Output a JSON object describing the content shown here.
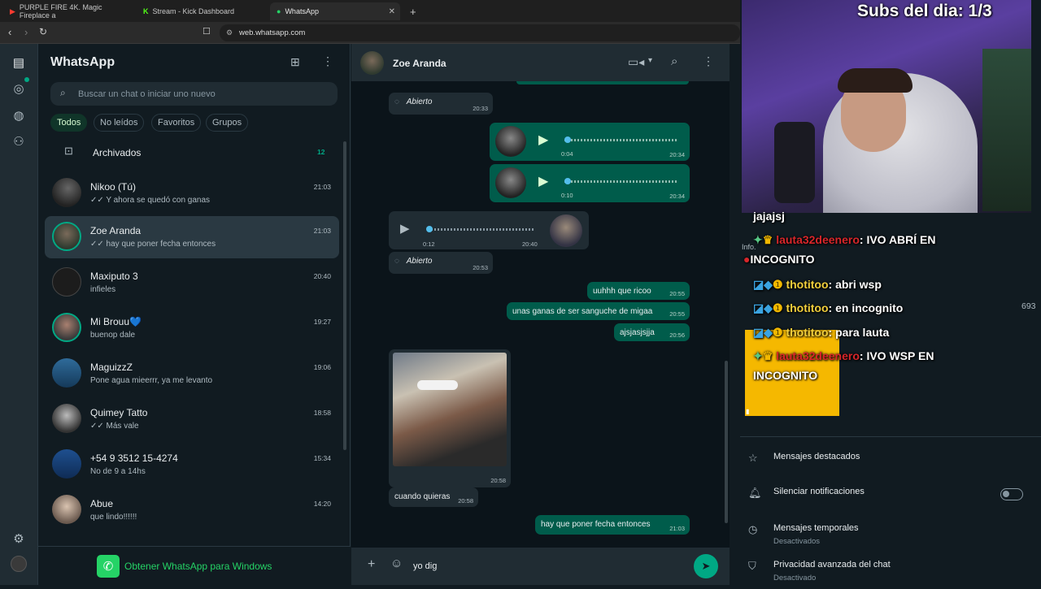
{
  "browser": {
    "tabs": [
      {
        "label": "PURPLE FIRE 4K. Magic Fireplace a"
      },
      {
        "label": "Stream - Kick Dashboard"
      },
      {
        "label": "WhatsApp"
      }
    ],
    "url": "web.whatsapp.com"
  },
  "sidebar": {
    "title": "WhatsApp",
    "search_placeholder": "Buscar un chat o iniciar uno nuevo",
    "filters": [
      "Todos",
      "No leídos",
      "Favoritos",
      "Grupos"
    ],
    "archived_label": "Archivados",
    "archived_count": "12",
    "chats": [
      {
        "name": "Nikoo (Tú)",
        "msg": "✓✓ Y ahora se quedó con ganas",
        "time": "21:03"
      },
      {
        "name": "Zoe Aranda",
        "msg": "✓✓ hay que poner fecha entonces",
        "time": "21:03"
      },
      {
        "name": "Maxiputo 3",
        "msg": "infieles",
        "time": "20:40"
      },
      {
        "name": "Mi Brouu💙",
        "msg": "buenop dale",
        "time": "19:27"
      },
      {
        "name": "MaguizzZ",
        "msg": "Pone agua mieerrr, ya me levanto",
        "time": "19:06"
      },
      {
        "name": "Quimey Tatto",
        "msg": "✓✓ Más vale",
        "time": "18:58"
      },
      {
        "name": "+54 9 3512 15-4274",
        "msg": "No de 9 a 14hs",
        "time": "15:34"
      },
      {
        "name": "Abue",
        "msg": "que lindo!!!!!!",
        "time": "14:20"
      }
    ],
    "get_windows": "Obtener WhatsApp para Windows"
  },
  "conversation": {
    "contact": "Zoe Aranda",
    "messages": {
      "opened1": {
        "text": "Abierto",
        "time": "20:33"
      },
      "audio1": {
        "dur": "0:04",
        "time": "20:34"
      },
      "audio2": {
        "dur": "0:10",
        "time": "20:34"
      },
      "audio3": {
        "dur": "0:12",
        "time": "20:40"
      },
      "opened2": {
        "text": "Abierto",
        "time": "20:53"
      },
      "m1": {
        "text": "uuhhh que ricoo",
        "time": "20:55"
      },
      "m2": {
        "text": "unas ganas de ser sanguche de migaa",
        "time": "20:55"
      },
      "m3": {
        "text": "ajsjasjsjja",
        "time": "20:56"
      },
      "img_time": "20:58",
      "m4": {
        "text": "cuando quieras",
        "time": "20:58"
      },
      "m5": {
        "text": "hay que poner fecha entonces",
        "time": "21:03"
      }
    },
    "draft": "yo dig"
  },
  "stream": {
    "subs": "Subs del dia: 1/3",
    "chat": [
      {
        "user": "",
        "text": "jajajsj"
      },
      {
        "user": "lauta32deenero",
        "text": ": IVO ABRÍ EN"
      },
      {
        "user": "",
        "text": "INCOGNITO"
      },
      {
        "user": "thotitoo",
        "text": ": abri wsp"
      },
      {
        "user": "thotitoo",
        "text": ": en incognito"
      },
      {
        "user": "thotitoo",
        "text": ": para lauta"
      },
      {
        "user": "lauta32deenero",
        "text": ": IVO WSP EN"
      },
      {
        "user": "",
        "text": "INCOGNITO"
      }
    ]
  },
  "contact_info": {
    "info_label": "Info.",
    "count": "693",
    "rows": [
      {
        "title": "Mensajes destacados",
        "sub": ""
      },
      {
        "title": "Silenciar notificaciones",
        "sub": ""
      },
      {
        "title": "Mensajes temporales",
        "sub": "Desactivados"
      },
      {
        "title": "Privacidad avanzada del chat",
        "sub": "Desactivado"
      }
    ]
  },
  "colors": {
    "accent": "#00a884",
    "outgoing": "#005c4b",
    "incoming": "#202c33"
  }
}
